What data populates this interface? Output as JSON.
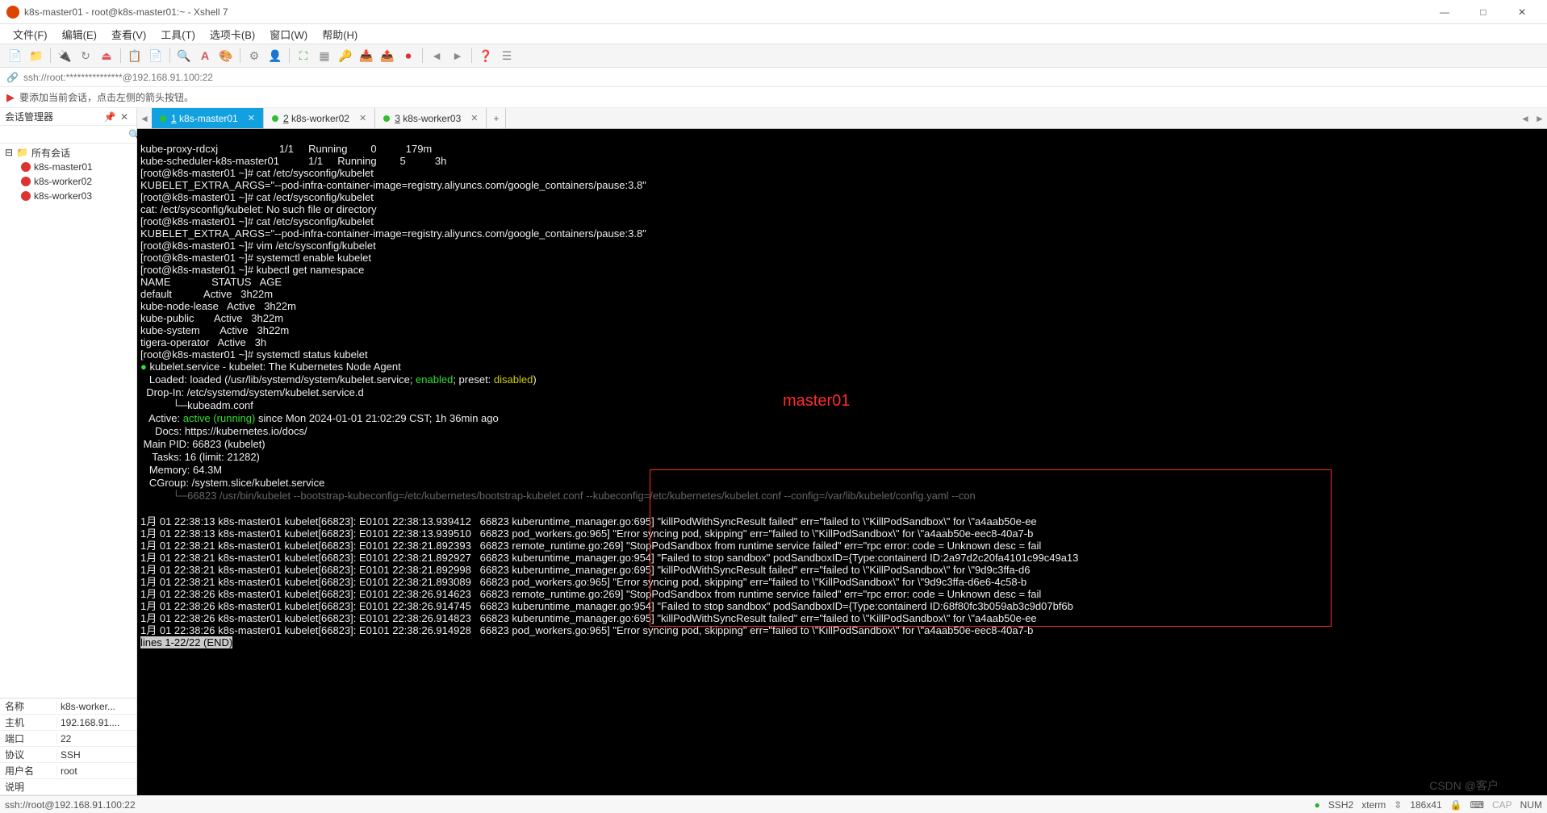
{
  "window": {
    "title": "k8s-master01 - root@k8s-master01:~ - Xshell 7",
    "controls": {
      "min": "—",
      "max": "□",
      "close": "✕"
    }
  },
  "menu": {
    "file": "文件(F)",
    "edit": "编辑(E)",
    "view": "查看(V)",
    "tools": "工具(T)",
    "tab": "选项卡(B)",
    "window": "窗口(W)",
    "help": "帮助(H)"
  },
  "address": {
    "link_icon": "🔗",
    "text": "ssh://root:***************@192.168.91.100:22"
  },
  "hint": {
    "text": "要添加当前会话，点击左侧的箭头按钮。"
  },
  "sidebar": {
    "title": "会话管理器",
    "search_placeholder": "",
    "root": "所有会话",
    "items": [
      {
        "label": "k8s-master01"
      },
      {
        "label": "k8s-worker02"
      },
      {
        "label": "k8s-worker03"
      }
    ],
    "props": {
      "name_k": "名称",
      "name_v": "k8s-worker...",
      "host_k": "主机",
      "host_v": "192.168.91....",
      "port_k": "端口",
      "port_v": "22",
      "proto_k": "协议",
      "proto_v": "SSH",
      "user_k": "用户名",
      "user_v": "root",
      "desc_k": "说明",
      "desc_v": ""
    }
  },
  "tabs": {
    "items": [
      {
        "num": "1",
        "label": "k8s-master01",
        "active": true
      },
      {
        "num": "2",
        "label": "k8s-worker02",
        "active": false
      },
      {
        "num": "3",
        "label": "k8s-worker03",
        "active": false
      }
    ],
    "add": "+"
  },
  "terminal": {
    "annotation": "master01",
    "lines": [
      "kube-proxy-rdcxj                     1/1     Running        0          179m",
      "kube-scheduler-k8s-master01          1/1     Running        5          3h",
      "[root@k8s-master01 ~]# cat /etc/sysconfig/kubelet",
      "KUBELET_EXTRA_ARGS=\"--pod-infra-container-image=registry.aliyuncs.com/google_containers/pause:3.8\"",
      "[root@k8s-master01 ~]# cat /ect/sysconfig/kubelet",
      "cat: /ect/sysconfig/kubelet: No such file or directory",
      "[root@k8s-master01 ~]# cat /etc/sysconfig/kubelet",
      "KUBELET_EXTRA_ARGS=\"--pod-infra-container-image=registry.aliyuncs.com/google_containers/pause:3.8\"",
      "[root@k8s-master01 ~]# vim /etc/sysconfig/kubelet",
      "[root@k8s-master01 ~]# systemctl enable kubelet",
      "[root@k8s-master01 ~]# kubectl get namespace",
      "NAME              STATUS   AGE",
      "default           Active   3h22m",
      "kube-node-lease   Active   3h22m",
      "kube-public       Active   3h22m",
      "kube-system       Active   3h22m",
      "tigera-operator   Active   3h",
      "[root@k8s-master01 ~]# systemctl status kubelet"
    ],
    "status_dot": "●",
    "status1": " kubelet.service - kubelet: The Kubernetes Node Agent",
    "status_loaded_pre": "   Loaded: loaded (/usr/lib/systemd/system/kubelet.service; ",
    "enabled": "enabled",
    "status_loaded_mid": "; preset: ",
    "disabled": "disabled",
    "status_loaded_post": ")",
    "dropin1": "  Drop-In: /etc/systemd/system/kubelet.service.d",
    "dropin2": "           └─kubeadm.conf",
    "active_pre": "   Active: ",
    "active_green": "active (running)",
    "active_post": " since Mon 2024-01-01 21:02:29 CST; 1h 36min ago",
    "docs": "     Docs: https://kubernetes.io/docs/",
    "mainpid": " Main PID: 66823 (kubelet)",
    "tasks": "    Tasks: 16 (limit: 21282)",
    "memory": "   Memory: 64.3M",
    "cgroup": "   CGroup: /system.slice/kubelet.service",
    "cgroup2_grey": "           └─66823 /usr/bin/kubelet --bootstrap-kubeconfig=/etc/kubernetes/bootstrap-kubelet.conf --kubeconfig=/etc/kubernetes/kubelet.conf --config=/var/lib/kubelet/config.yaml --con",
    "blank": "",
    "logs": [
      "1月 01 22:38:13 k8s-master01 kubelet[66823]: E0101 22:38:13.939412   66823 kuberuntime_manager.go:695] \"killPodWithSyncResult failed\" err=\"failed to \\\"KillPodSandbox\\\" for \\\"a4aab50e-ee",
      "1月 01 22:38:13 k8s-master01 kubelet[66823]: E0101 22:38:13.939510   66823 pod_workers.go:965] \"Error syncing pod, skipping\" err=\"failed to \\\"KillPodSandbox\\\" for \\\"a4aab50e-eec8-40a7-b",
      "1月 01 22:38:21 k8s-master01 kubelet[66823]: E0101 22:38:21.892393   66823 remote_runtime.go:269] \"StopPodSandbox from runtime service failed\" err=\"rpc error: code = Unknown desc = fail",
      "1月 01 22:38:21 k8s-master01 kubelet[66823]: E0101 22:38:21.892927   66823 kuberuntime_manager.go:954] \"Failed to stop sandbox\" podSandboxID={Type:containerd ID:2a97d2c20fa4101c99c49a13",
      "1月 01 22:38:21 k8s-master01 kubelet[66823]: E0101 22:38:21.892998   66823 kuberuntime_manager.go:695] \"killPodWithSyncResult failed\" err=\"failed to \\\"KillPodSandbox\\\" for \\\"9d9c3ffa-d6",
      "1月 01 22:38:21 k8s-master01 kubelet[66823]: E0101 22:38:21.893089   66823 pod_workers.go:965] \"Error syncing pod, skipping\" err=\"failed to \\\"KillPodSandbox\\\" for \\\"9d9c3ffa-d6e6-4c58-b",
      "1月 01 22:38:26 k8s-master01 kubelet[66823]: E0101 22:38:26.914623   66823 remote_runtime.go:269] \"StopPodSandbox from runtime service failed\" err=\"rpc error: code = Unknown desc = fail",
      "1月 01 22:38:26 k8s-master01 kubelet[66823]: E0101 22:38:26.914745   66823 kuberuntime_manager.go:954] \"Failed to stop sandbox\" podSandboxID={Type:containerd ID:68f80fc3b059ab3c9d07bf6b",
      "1月 01 22:38:26 k8s-master01 kubelet[66823]: E0101 22:38:26.914823   66823 kuberuntime_manager.go:695] \"killPodWithSyncResult failed\" err=\"failed to \\\"KillPodSandbox\\\" for \\\"a4aab50e-ee",
      "1月 01 22:38:26 k8s-master01 kubelet[66823]: E0101 22:38:26.914928   66823 pod_workers.go:965] \"Error syncing pod, skipping\" err=\"failed to \\\"KillPodSandbox\\\" for \\\"a4aab50e-eec8-40a7-b"
    ],
    "end_line": "lines 1-22/22 (END)"
  },
  "status": {
    "left": "ssh://root@192.168.91.100:22",
    "ssh": "SSH2",
    "term": "xterm",
    "size_icon": "⇳",
    "size": "186x41",
    "enc_icon": "🔒",
    "kb_icon": "⌨",
    "caps": "CAP",
    "num": "NUM"
  },
  "watermark": "CSDN @客户"
}
